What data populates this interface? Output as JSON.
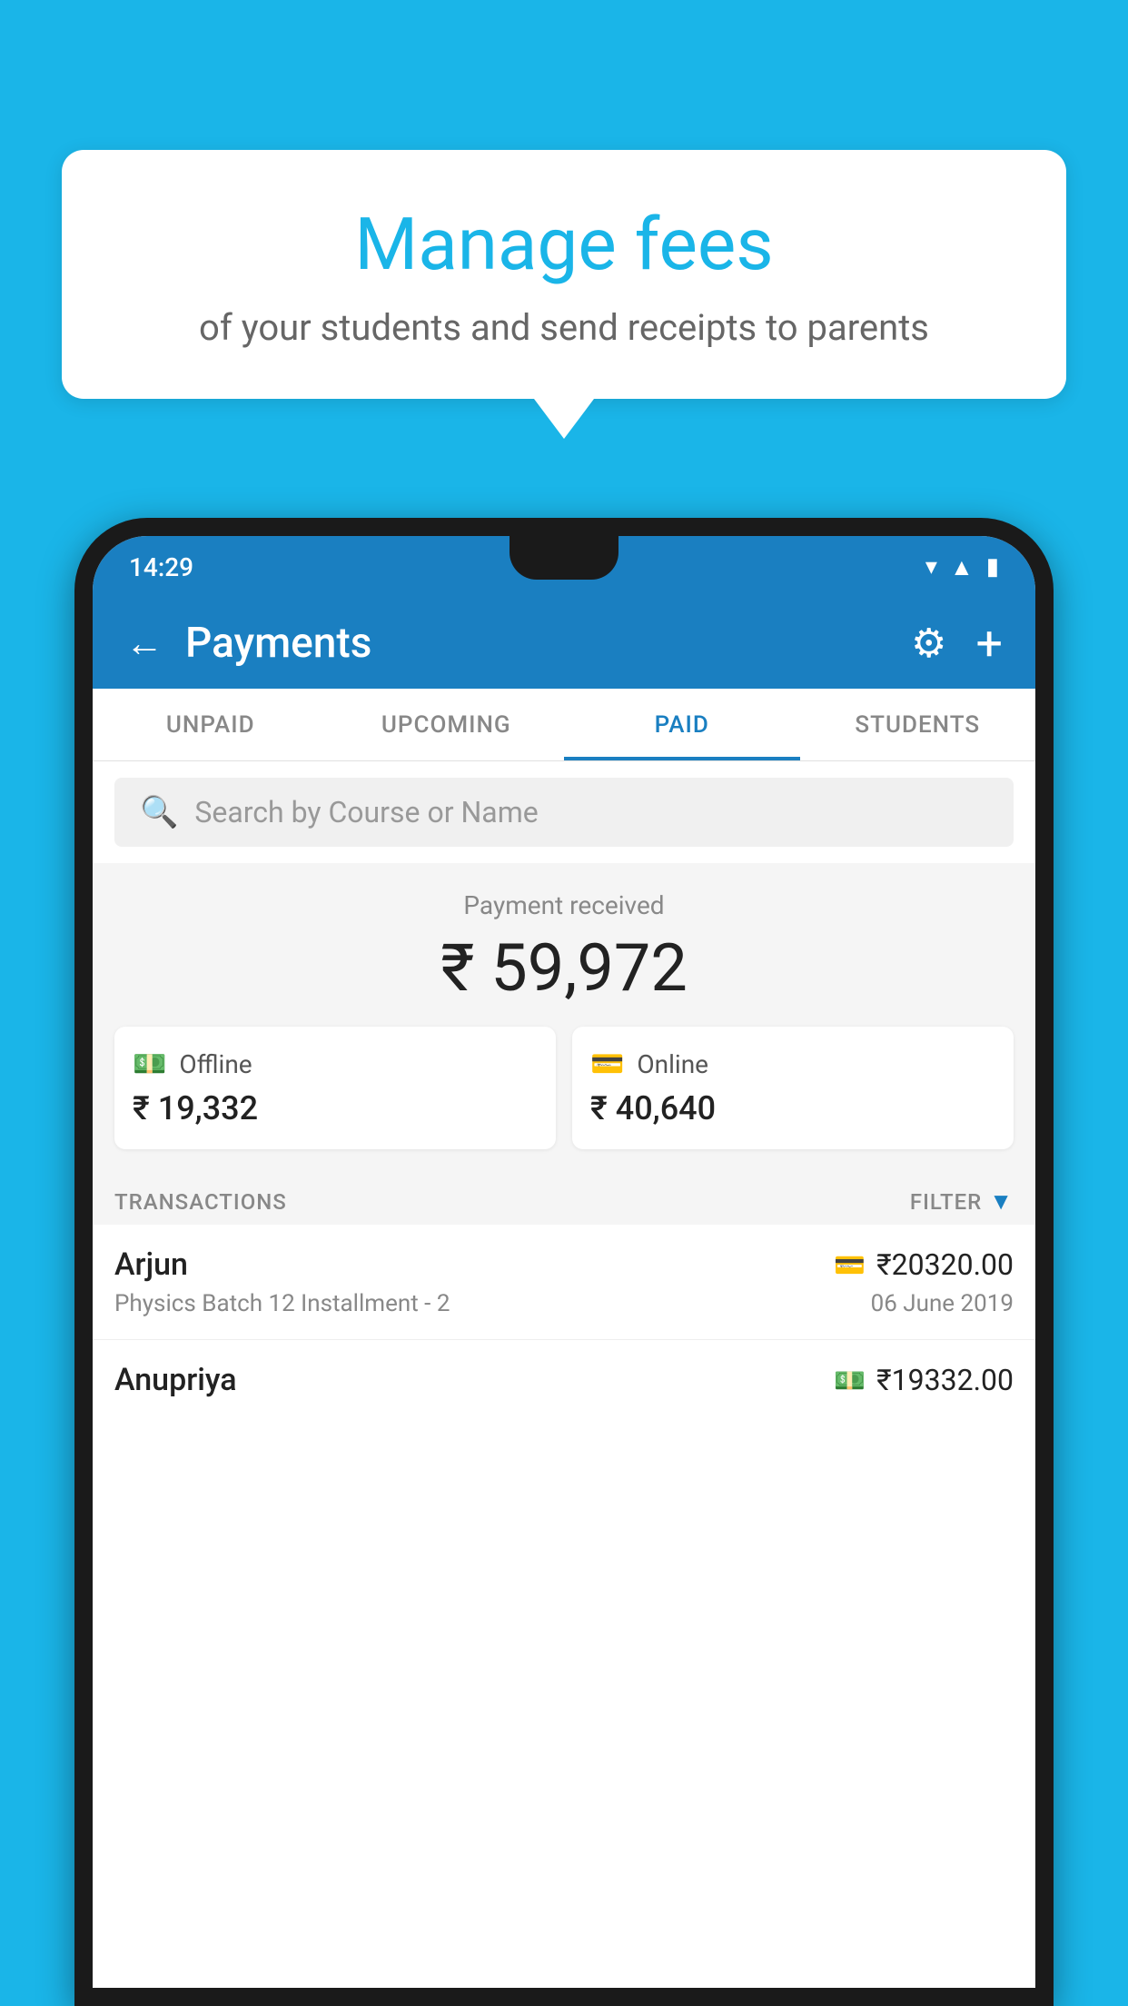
{
  "background_color": "#1ab5e8",
  "speech_bubble": {
    "title": "Manage fees",
    "subtitle": "of your students and send receipts to parents"
  },
  "status_bar": {
    "time": "14:29"
  },
  "header": {
    "title": "Payments",
    "back_label": "←",
    "settings_icon": "⚙",
    "add_icon": "+"
  },
  "tabs": [
    {
      "label": "UNPAID",
      "active": false
    },
    {
      "label": "UPCOMING",
      "active": false
    },
    {
      "label": "PAID",
      "active": true
    },
    {
      "label": "STUDENTS",
      "active": false
    }
  ],
  "search": {
    "placeholder": "Search by Course or Name"
  },
  "payment_summary": {
    "label": "Payment received",
    "total": "₹ 59,972",
    "offline_label": "Offline",
    "offline_amount": "₹ 19,332",
    "online_label": "Online",
    "online_amount": "₹ 40,640"
  },
  "transactions": {
    "section_label": "TRANSACTIONS",
    "filter_label": "FILTER",
    "items": [
      {
        "name": "Arjun",
        "amount": "₹20320.00",
        "course": "Physics Batch 12 Installment - 2",
        "date": "06 June 2019",
        "icon_type": "card"
      },
      {
        "name": "Anupriya",
        "amount": "₹19332.00",
        "course": "",
        "date": "",
        "icon_type": "cash"
      }
    ]
  }
}
